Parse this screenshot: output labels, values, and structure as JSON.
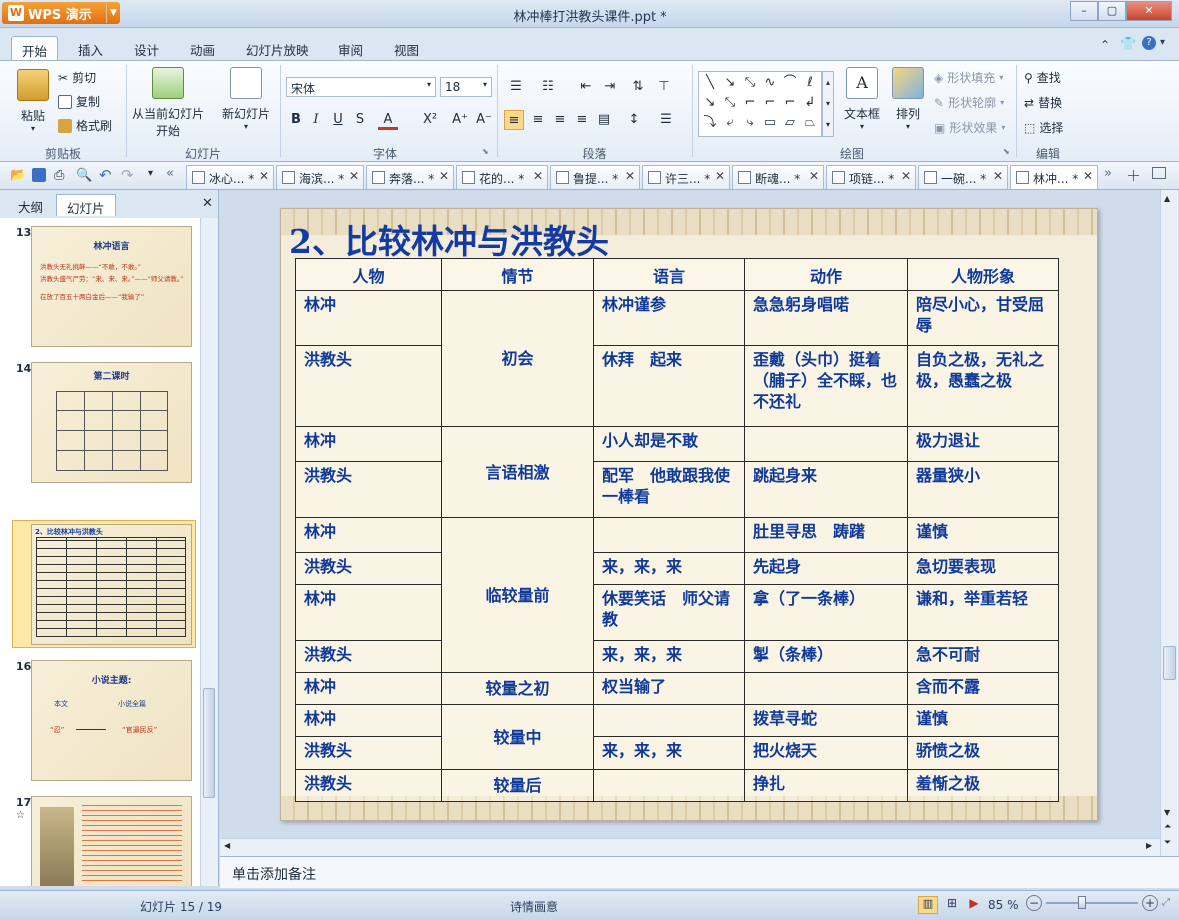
{
  "app": {
    "name": "WPS 演示",
    "window_title": "林冲棒打洪教头课件.ppt *"
  },
  "menu_tabs": [
    "开始",
    "插入",
    "设计",
    "动画",
    "幻灯片放映",
    "审阅",
    "视图"
  ],
  "ribbon": {
    "clipboard": {
      "paste": "粘贴",
      "cut": "剪切",
      "copy": "复制",
      "format_painter": "格式刷",
      "label": "剪贴板"
    },
    "slides": {
      "from_current": "从当前幻灯片",
      "start": "开始",
      "new_slide": "新幻灯片",
      "label": "幻灯片"
    },
    "font": {
      "name": "宋体",
      "size": "18",
      "label": "字体"
    },
    "paragraph": {
      "label": "段落"
    },
    "drawing": {
      "textbox": "文本框",
      "arrange": "排列",
      "shape_fill": "形状填充",
      "shape_outline": "形状轮廓",
      "shape_effect": "形状效果",
      "label": "绘图"
    },
    "edit": {
      "find": "查找",
      "replace": "替换",
      "select": "选择",
      "label": "编辑"
    }
  },
  "doc_tabs": [
    "冰心... *",
    "海滨... *",
    "奔落... *",
    "花的... *",
    "鲁提... *",
    "许三... *",
    "断魂... *",
    "项链... *",
    "一碗... *",
    "林冲... *"
  ],
  "panel": {
    "tabs": [
      "大纲",
      "幻灯片"
    ],
    "thumbs": [
      {
        "num": "13",
        "title": "林冲语言",
        "lines": [
          "洪教头无礼挑衅——“不敢，不敢。”",
          "洪教头盛气尸劳：“来、来、来。”——“师父请教。”",
          "在放了百五十两白金后——“我输了”"
        ]
      },
      {
        "num": "14",
        "title": "第二课时"
      },
      {
        "num": "15",
        "title": "2、比较林冲与洪教头"
      },
      {
        "num": "16",
        "title": "小说主题:",
        "lines": [
          "本文",
          "小说全篇",
          "“忍”",
          "“官逼民反”"
        ]
      },
      {
        "num": "17"
      }
    ]
  },
  "slide": {
    "title": "2、比较林冲与洪教头",
    "headers": [
      "人物",
      "情节",
      "语言",
      "动作",
      "人物形象"
    ],
    "rows": [
      [
        "林冲",
        "初会",
        "林冲谨参",
        "急急躬身唱喏",
        "陪尽小心，甘受屈辱"
      ],
      [
        "洪教头",
        "",
        "休拜　起来",
        "歪戴（头巾）挺着（脯子）全不睬，也不还礼",
        "自负之极，无礼之极，愚蠢之极"
      ],
      [
        "林冲",
        "言语相激",
        "小人却是不敢",
        "",
        "极力退让"
      ],
      [
        "洪教头",
        "",
        "配军　他敢跟我使一棒看",
        "跳起身来",
        "器量狭小"
      ],
      [
        "林冲",
        "临较量前",
        "",
        "肚里寻思　踌躇",
        "谨慎"
      ],
      [
        "洪教头",
        "",
        "来，来，来",
        "先起身",
        "急切要表现"
      ],
      [
        "林冲",
        "",
        "休要笑话　师父请教",
        "拿（了一条棒）",
        "谦和，举重若轻"
      ],
      [
        "洪教头",
        "",
        "来，来，来",
        "掣（条棒）",
        "急不可耐"
      ],
      [
        "林冲",
        "较量之初",
        "权当输了",
        "",
        "含而不露"
      ],
      [
        "林冲",
        "较量中",
        "",
        "拨草寻蛇",
        "谨慎"
      ],
      [
        "洪教头",
        "",
        "来，来，来",
        "把火烧天",
        "骄愤之极"
      ],
      [
        "洪教头",
        "较量后",
        "",
        "挣扎",
        "羞惭之极"
      ]
    ]
  },
  "notes": "单击添加备注",
  "status": {
    "slide_info": "幻灯片 15 / 19",
    "theme": "诗情画意",
    "zoom": "85 %"
  }
}
